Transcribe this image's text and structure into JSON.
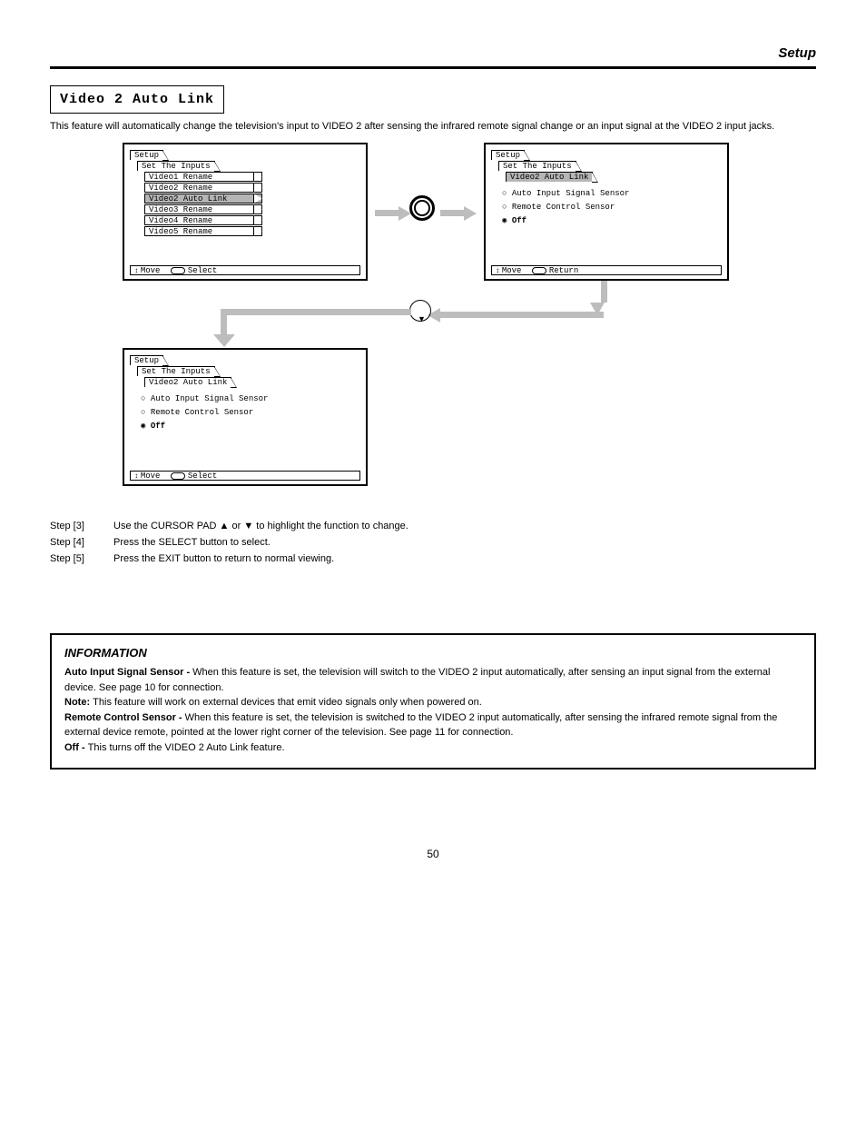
{
  "doc": {
    "section_header": "Setup",
    "title_box": "Video 2 Auto Link",
    "intro": "This feature will automatically change the television's input to VIDEO 2 after sensing the infrared remote signal change or an input signal at the VIDEO 2 input jacks.",
    "page_number": "50"
  },
  "osd": {
    "tab_setup": "Setup",
    "tab_set_inputs": "Set The Inputs",
    "tab_v2al": "Video2 Auto Link",
    "items": {
      "v1": "Video1 Rename",
      "v2r": "Video2 Rename",
      "v2al": "Video2 Auto Link",
      "v3": "Video3 Rename",
      "v4": "Video4 Rename",
      "v5": "Video5 Rename"
    },
    "radios": {
      "auto": "Auto Input Signal Sensor",
      "remote": "Remote Control Sensor",
      "off": "Off"
    },
    "footer": {
      "move": "Move",
      "select": "Select",
      "ret": "Return"
    }
  },
  "steps": {
    "s3a": "Step [3] ",
    "s3b": "Use the CURSOR PAD ▲ or ▼ to highlight the function to change.",
    "s4a": "Step [4] ",
    "s4b": "Press the SELECT button to select.",
    "s5a": "Step [5] ",
    "s5b": "Press the EXIT button to return to normal viewing."
  },
  "info": {
    "hdr": "                                                                    INFORMATION",
    "p1_label": "Auto Input Signal Sensor - ",
    "p1_body": "When this feature is set, the television will switch to the VIDEO 2 input automatically, after sensing an input signal from the external device. See page 10 for connection.",
    "note_label": "Note: ",
    "note_body": "This feature will work on external devices that emit video signals only when powered on.",
    "p2_label": "Remote Control Sensor - ",
    "p2_body": "When this feature is set, the television is switched to the VIDEO 2 input automatically, after sensing the infrared remote signal from the external device remote, pointed at the lower right corner of the television. See page 11 for connection.",
    "p3_label": "Off - ",
    "p3_body": "This turns off the VIDEO 2 Auto Link feature."
  }
}
